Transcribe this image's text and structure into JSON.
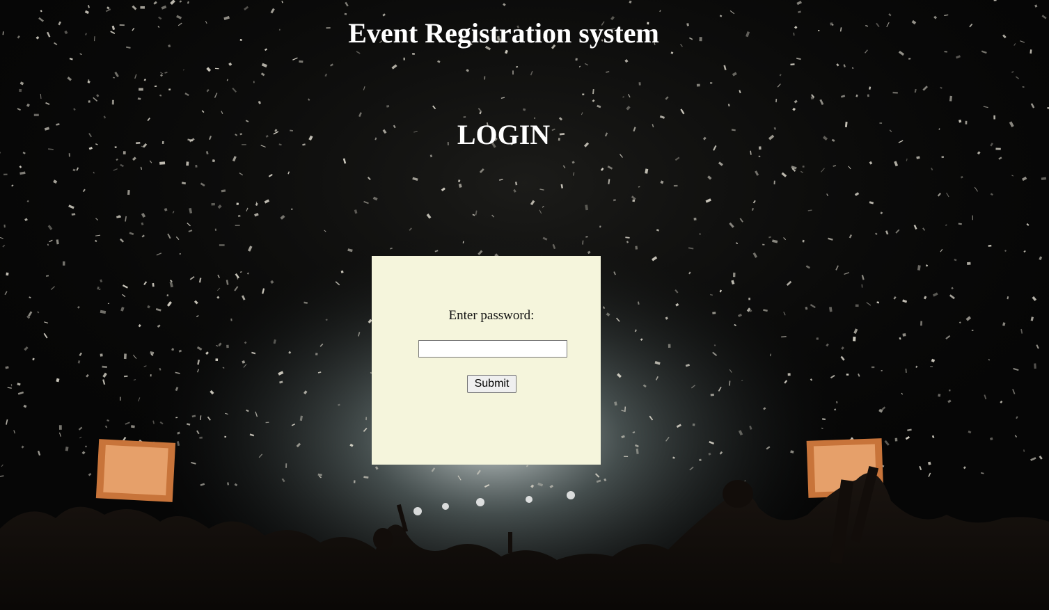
{
  "page": {
    "title": "Event Registration system"
  },
  "login": {
    "heading": "LOGIN",
    "password_label": "Enter password:",
    "password_value": "",
    "submit_label": "Submit"
  },
  "colors": {
    "title_text": "#ffffff",
    "login_box_bg": "#f5f5dc",
    "page_bg": "#050505"
  },
  "background": {
    "description_icon": "concert-crowd-confetti-background"
  }
}
